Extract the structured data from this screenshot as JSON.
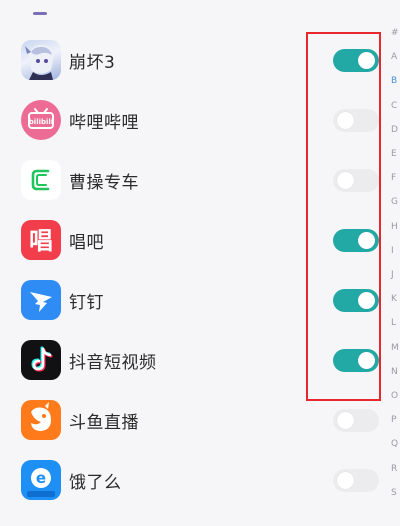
{
  "apps": [
    {
      "name": "崩坏3",
      "icon": "honkai-impact-3-icon",
      "enabled": true
    },
    {
      "name": "哔哩哔哩",
      "icon": "bilibili-icon",
      "enabled": false
    },
    {
      "name": "曹操专车",
      "icon": "caocao-chuxing-icon",
      "enabled": false
    },
    {
      "name": "唱吧",
      "icon": "changba-icon",
      "enabled": true
    },
    {
      "name": "钉钉",
      "icon": "dingtalk-icon",
      "enabled": true
    },
    {
      "name": "抖音短视频",
      "icon": "douyin-icon",
      "enabled": true
    },
    {
      "name": "斗鱼直播",
      "icon": "douyu-icon",
      "enabled": false
    },
    {
      "name": "饿了么",
      "icon": "eleme-icon",
      "enabled": false
    }
  ],
  "index_letters": [
    "#",
    "A",
    "B",
    "C",
    "D",
    "E",
    "F",
    "G",
    "H",
    "I",
    "J",
    "K",
    "L",
    "M",
    "N",
    "O",
    "P",
    "Q",
    "R",
    "S"
  ],
  "index_active": "B",
  "colors": {
    "toggle_on": "#22a9a6",
    "toggle_off": "#ececef",
    "highlight_border": "#e8262e",
    "index_active": "#4a8fd8"
  },
  "icon_texts": {
    "bilibili": "bilibili",
    "changba": "唱",
    "eleme": "e"
  }
}
